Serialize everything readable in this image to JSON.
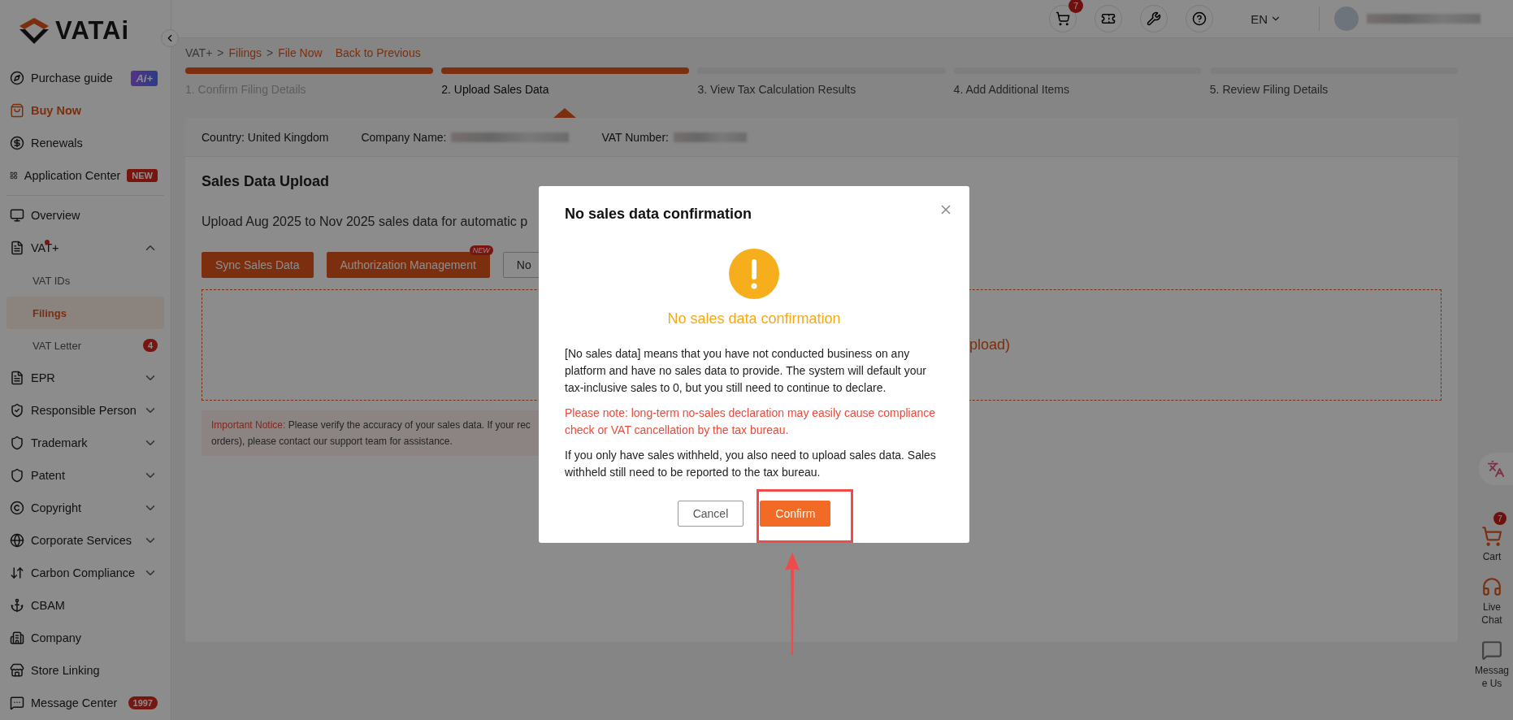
{
  "sidebar": {
    "logo_text": "VATAi",
    "items": [
      {
        "label": "Purchase guide",
        "kind": "item",
        "badge": {
          "text": "Ai+",
          "kind": "ai"
        }
      },
      {
        "label": "Buy Now",
        "kind": "promo"
      },
      {
        "label": "Renewals",
        "kind": "item"
      },
      {
        "label": "Application Center",
        "kind": "item",
        "badge": {
          "text": "NEW",
          "kind": "new"
        }
      },
      {
        "label": "Overview",
        "kind": "item",
        "divider_before": true
      },
      {
        "label": "VAT+",
        "kind": "item",
        "dot": true,
        "expanded": true,
        "children": [
          {
            "label": "VAT IDs",
            "selected": false
          },
          {
            "label": "Filings",
            "selected": true
          },
          {
            "label": "VAT Letter",
            "selected": false,
            "badge": "4"
          }
        ]
      },
      {
        "label": "EPR",
        "kind": "item",
        "expanded": false
      },
      {
        "label": "Responsible Person",
        "kind": "item",
        "expanded": false
      },
      {
        "label": "Trademark",
        "kind": "item",
        "expanded": false
      },
      {
        "label": "Patent",
        "kind": "item",
        "expanded": false
      },
      {
        "label": "Copyright",
        "kind": "item",
        "expanded": false
      },
      {
        "label": "Corporate Services",
        "kind": "item",
        "expanded": false
      },
      {
        "label": "Carbon Compliance",
        "kind": "item",
        "expanded": false
      },
      {
        "label": "CBAM",
        "kind": "item"
      },
      {
        "label": "Company",
        "kind": "item"
      },
      {
        "label": "Store Linking",
        "kind": "item"
      },
      {
        "label": "Message Center",
        "kind": "item",
        "badge": {
          "text": "1997",
          "kind": "count"
        }
      }
    ]
  },
  "topbar": {
    "cart_count": "7",
    "language": "EN"
  },
  "breadcrumb": {
    "items": [
      "VAT+",
      "Filings",
      "File Now"
    ],
    "separator": ">",
    "back_link": "Back to Previous"
  },
  "steps": [
    {
      "label": "1. Confirm Filing Details",
      "completed": true,
      "selected": false
    },
    {
      "label": "2. Upload Sales Data",
      "completed": true,
      "selected": true
    },
    {
      "label": "3. View Tax Calculation Results",
      "completed": false,
      "selected": false
    },
    {
      "label": "4. Add Additional Items",
      "completed": false,
      "selected": false
    },
    {
      "label": "5. Review Filing Details",
      "completed": false,
      "selected": false
    }
  ],
  "info_bar": {
    "country": "Country: United Kingdom",
    "company_label": "Company Name:",
    "vat_label": "VAT Number:"
  },
  "upload": {
    "title": "Sales Data Upload",
    "description": "Upload Aug 2025 to Nov 2025 sales data for automatic p",
    "buttons": [
      {
        "label": "Sync Sales Data",
        "kind": "primary"
      },
      {
        "label": "Authorization Management",
        "kind": "primary",
        "badge": "NEW"
      },
      {
        "label": "No",
        "kind": "outline"
      }
    ],
    "dropzone_text": "pload)",
    "notice_label": "Important Notice:",
    "notice_line1": "Please verify the accuracy of your sales data. If your rec",
    "notice_line2": "orders), please contact our support team for assistance."
  },
  "right_rail": [
    {
      "label": "Cart",
      "badge": "7",
      "kind": "cart"
    },
    {
      "label": "Live Chat",
      "kind": "chat"
    },
    {
      "label": "Messag e Us",
      "kind": "message"
    }
  ],
  "modal": {
    "title": "No sales data confirmation",
    "subtitle": "No sales data confirmation",
    "paragraphs": [
      {
        "text": "[No sales data] means that you have not conducted business on any platform and have no sales data to provide. The system will default your tax-inclusive sales to 0, but you still need to continue to declare.",
        "kind": "normal"
      },
      {
        "text": "Please note: long-term no-sales declaration may easily cause compliance check or VAT cancellation by the tax bureau.",
        "kind": "warning"
      },
      {
        "text": "If you only have sales withheld, you also need to upload sales data. Sales withheld still need to be reported to the tax bureau.",
        "kind": "normal"
      }
    ],
    "buttons": [
      {
        "label": "Cancel",
        "kind": "default"
      },
      {
        "label": "Confirm",
        "kind": "primary",
        "highlighted": true
      }
    ]
  }
}
